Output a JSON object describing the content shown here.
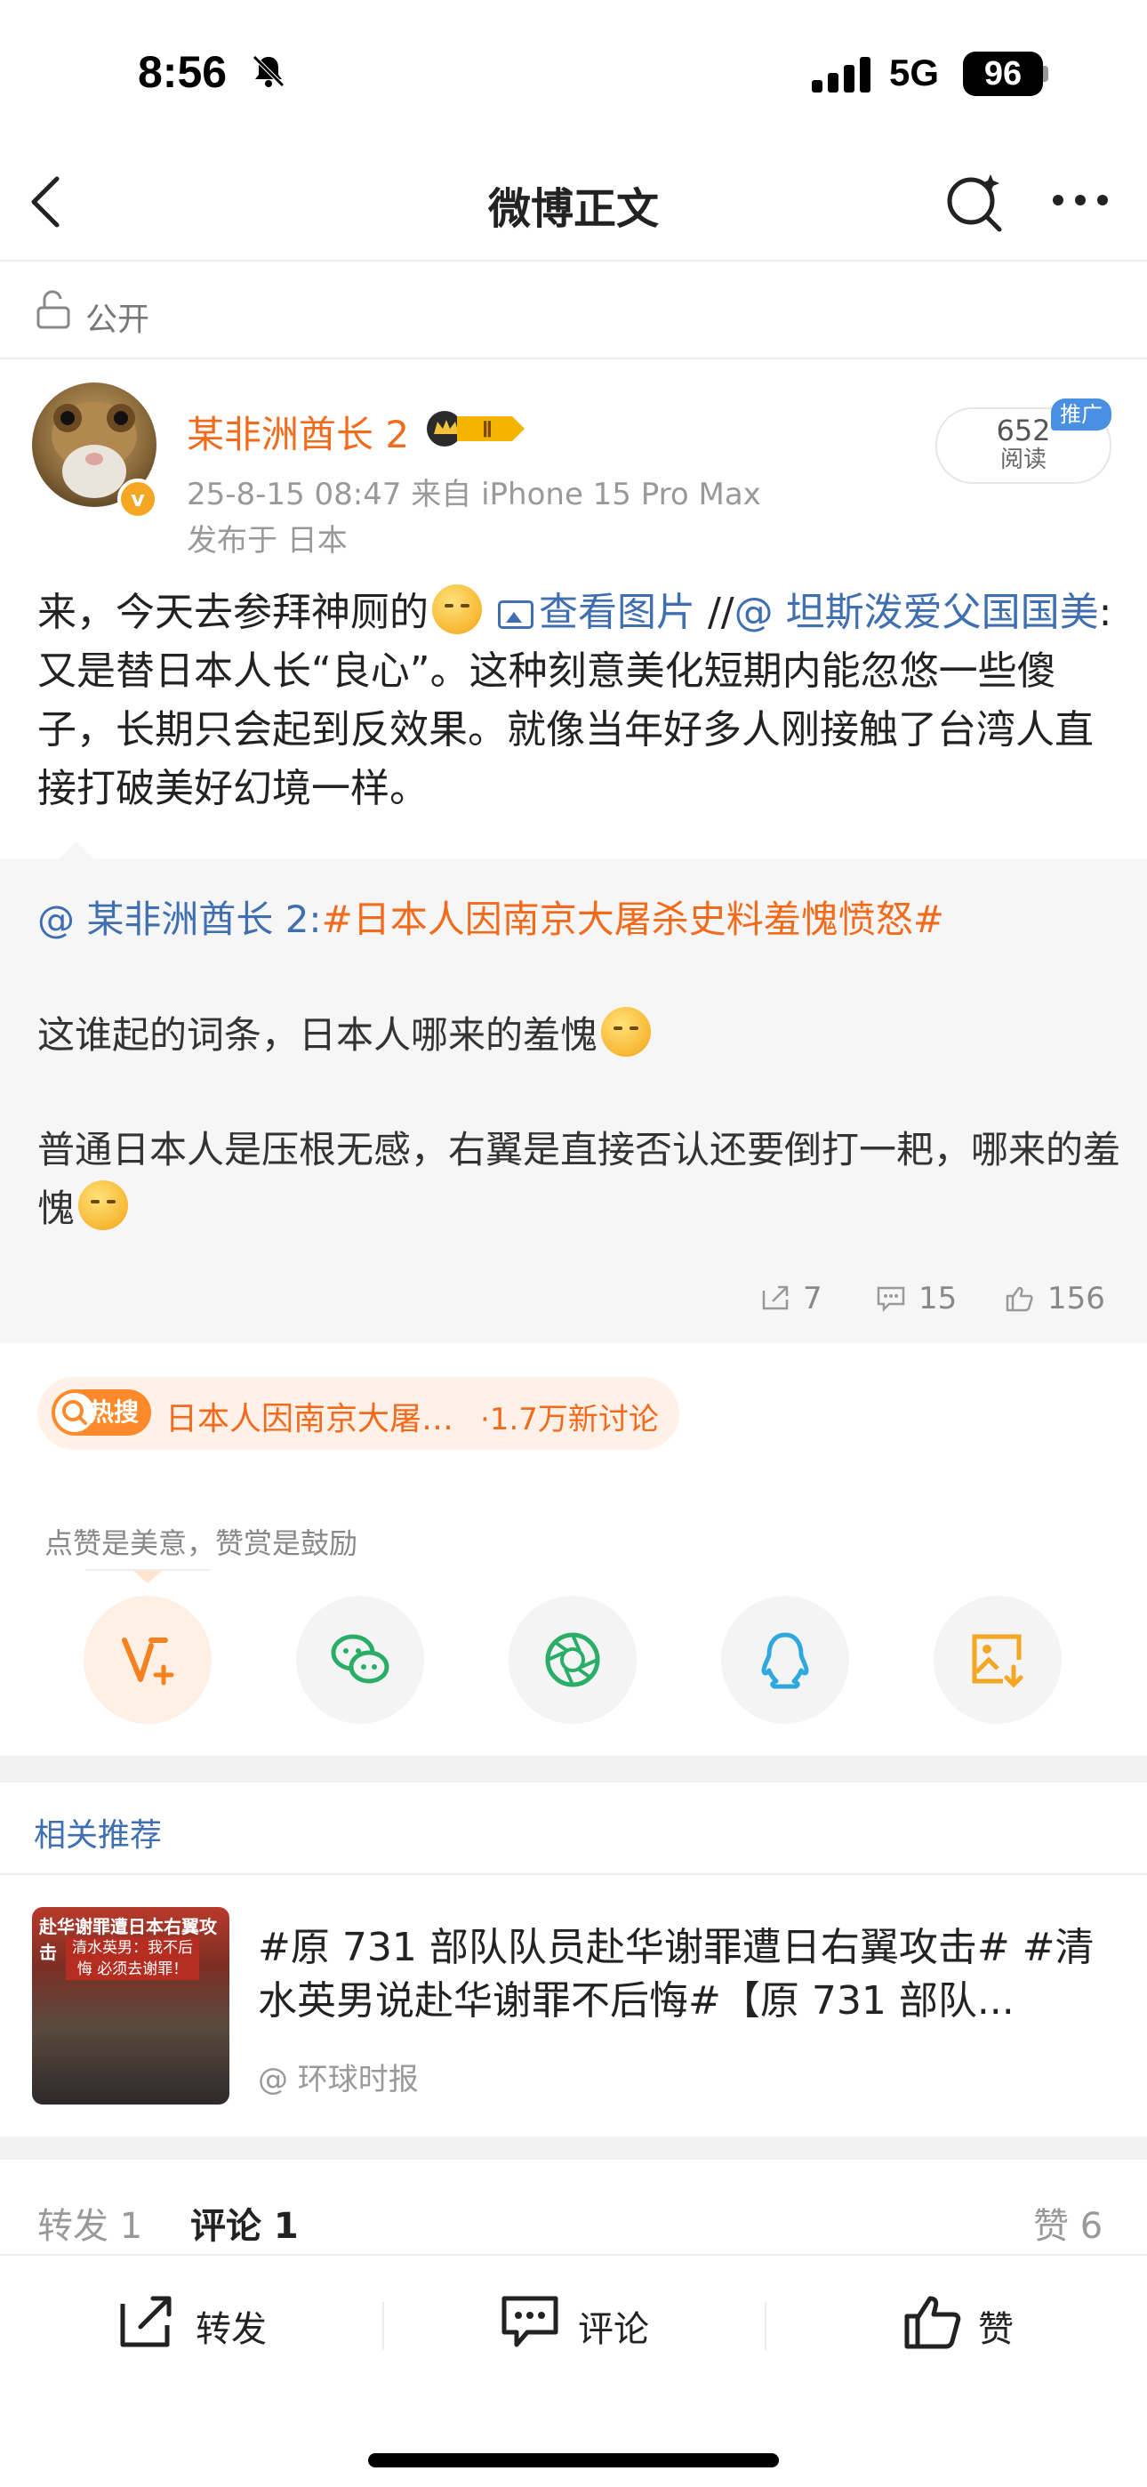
{
  "status_bar": {
    "time": "8:56",
    "network": "5G",
    "battery": "96"
  },
  "nav": {
    "title": "微博正文"
  },
  "visibility": {
    "label": "公开"
  },
  "author": {
    "name": "某非洲酋长 2",
    "vip_level": "Ⅱ",
    "time_source": "25-8-15 08:47  来自 iPhone 15 Pro Max",
    "location": "发布于 日本",
    "verified_badge": "v"
  },
  "read": {
    "count": "652",
    "label": "阅读",
    "promo": "推广"
  },
  "post": {
    "line1_a": "来，今天去参拜神厕的",
    "view_image": "查看图片",
    "repost_sep": " //",
    "mention": "@ 坦斯泼爱父国国美",
    "body": ":又是替日本人长“良心”。这种刻意美化短期内能忽悠一些傻子，长期只会起到反效果。就像当年好多人刚接触了台湾人直接打破美好幻境一样。"
  },
  "quote": {
    "author": "@ 某非洲酋长 2:",
    "topic": "#日本人因南京大屠杀史料羞愧愤怒#",
    "para1": "这谁起的词条，日本人哪来的羞愧",
    "para2": "普通日本人是压根无感，右翼是直接否认还要倒打一耙，哪来的羞愧",
    "reposts": "7",
    "comments": "15",
    "likes": "156"
  },
  "hot_search": {
    "badge": "热搜",
    "topic": "日本人因南京大屠…",
    "count": "·1.7万新讨论"
  },
  "reward": {
    "label": "点赞是美意，赞赏是鼓励"
  },
  "share_icons": [
    "vplus-icon",
    "wechat-icon",
    "moments-icon",
    "qq-icon",
    "save-image-icon"
  ],
  "related": {
    "title": "相关推荐",
    "thumb_title": "赴华谢罪遭日本右翼攻击",
    "thumb_sub": "清水英男：我不后悔 必须去谢罪！",
    "text": "#原 731 部队队员赴华谢罪遭日右翼攻击# #清水英男说赴华谢罪不后悔#【原 731 部队...",
    "source": "@ 环球时报"
  },
  "tabs": {
    "repost": "转发 1",
    "comment": "评论 1",
    "like": "赞 6"
  },
  "bottom_bar": {
    "repost": "转发",
    "comment": "评论",
    "like": "赞"
  },
  "colors": {
    "accent_blue": "#3f6fb1",
    "accent_orange": "#f26b1d"
  }
}
